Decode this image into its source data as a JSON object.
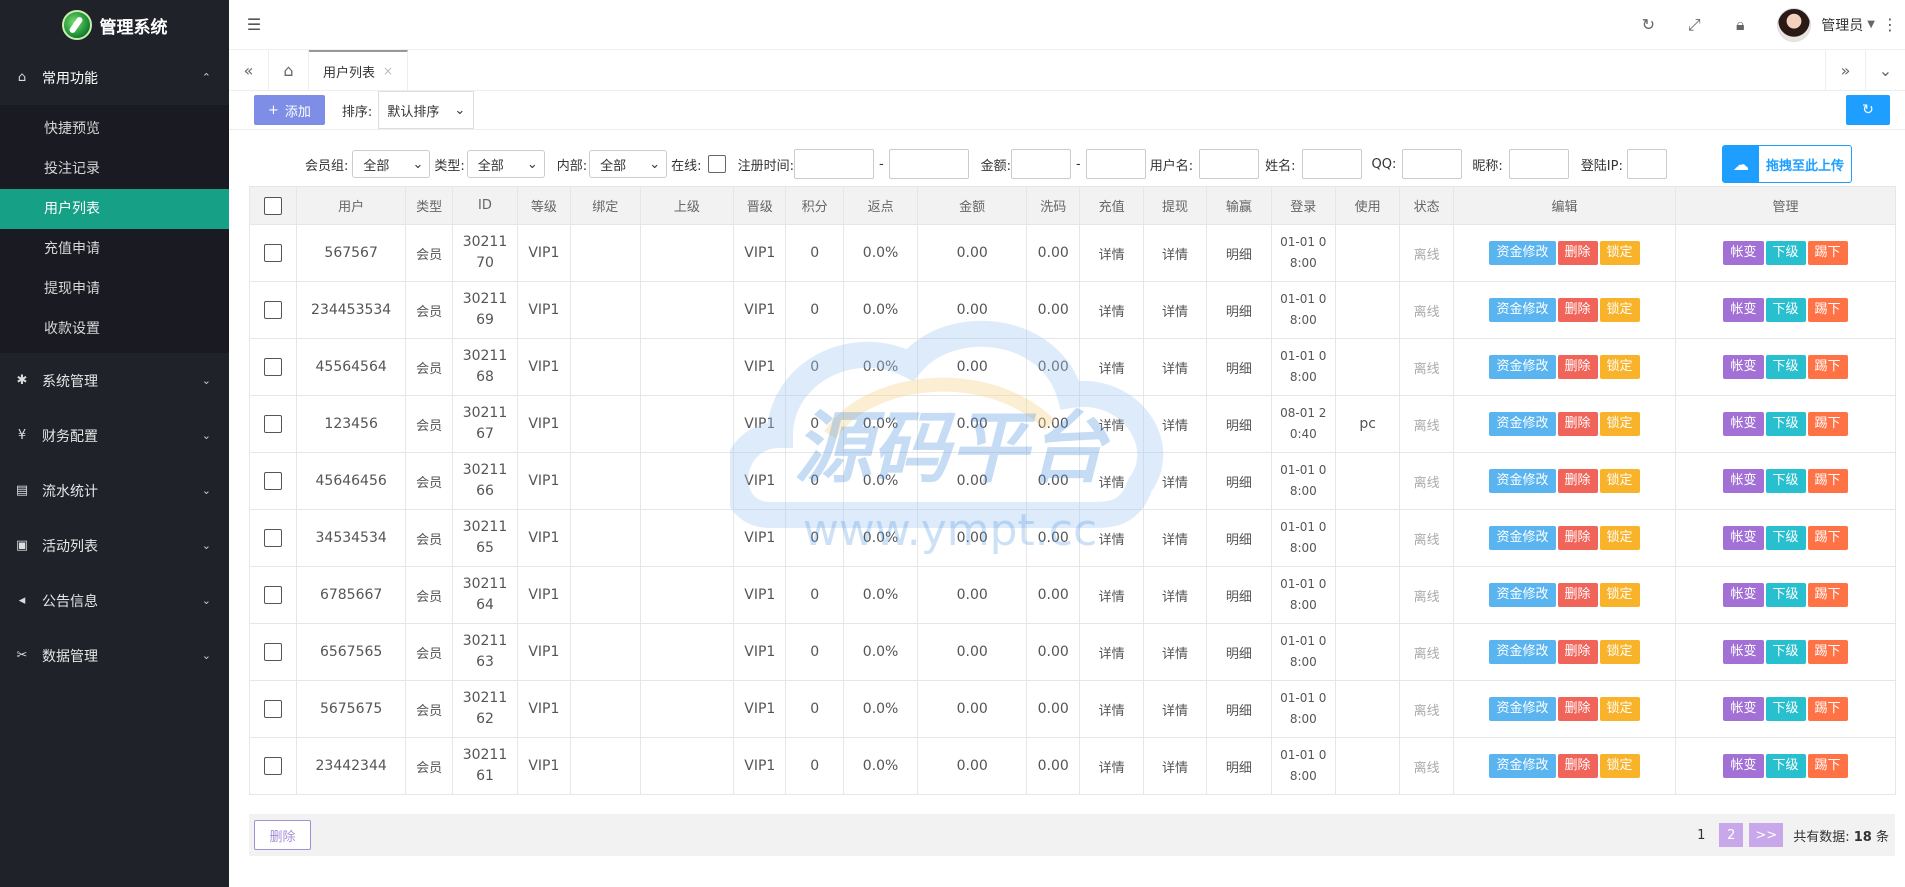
{
  "app": {
    "title": "管理系统"
  },
  "sidebar": {
    "groups": [
      {
        "label": "常用功能",
        "icon": "home-icon",
        "open": true,
        "items": [
          {
            "label": "快捷预览"
          },
          {
            "label": "投注记录"
          },
          {
            "label": "用户列表",
            "active": true
          },
          {
            "label": "充值申请"
          },
          {
            "label": "提现申请"
          },
          {
            "label": "收款设置"
          }
        ]
      },
      {
        "label": "系统管理",
        "icon": "gear-icon"
      },
      {
        "label": "财务配置",
        "icon": "yen-icon"
      },
      {
        "label": "流水统计",
        "icon": "report-icon"
      },
      {
        "label": "活动列表",
        "icon": "gift-icon"
      },
      {
        "label": "公告信息",
        "icon": "speaker-icon"
      },
      {
        "label": "数据管理",
        "icon": "tools-icon"
      }
    ]
  },
  "header": {
    "user_name": "管理员"
  },
  "tabs": [
    {
      "label": "用户列表",
      "close": "×"
    }
  ],
  "toolbar": {
    "add_label": "添加",
    "sort_label": "排序:",
    "sort_value": "默认排序"
  },
  "filters": {
    "member_group_label": "会员组:",
    "member_group_value": "全部",
    "type_label": "类型:",
    "type_value": "全部",
    "internal_label": "内部:",
    "internal_value": "全部",
    "online_label": "在线:",
    "reg_time_label": "注册时间:",
    "dash": "-",
    "amount_label": "金额:",
    "username_label": "用户名:",
    "realname_label": "姓名:",
    "qq_label": "QQ:",
    "nickname_label": "昵称:",
    "login_ip_label": "登陆IP:",
    "upload_label": "拖拽至此上传"
  },
  "table": {
    "columns": [
      "用户",
      "类型",
      "ID",
      "等级",
      "绑定",
      "上级",
      "晋级",
      "积分",
      "返点",
      "金额",
      "洗码",
      "充值",
      "提现",
      "输赢",
      "登录",
      "使用",
      "状态",
      "编辑",
      "管理"
    ],
    "actions": {
      "edit_funds": "资金修改",
      "delete": "删除",
      "lock": "锁定",
      "change": "帐变",
      "downline": "下级",
      "kick": "踢下"
    },
    "rows": [
      {
        "user": "567567",
        "type": "会员",
        "id_a": "30211",
        "id_b": "70",
        "level": "VIP1",
        "bind": "",
        "parent": "",
        "promo": "VIP1",
        "points": "0",
        "rebate": "0.0%",
        "amount": "0.00",
        "wash": "0.00",
        "recharge": "详情",
        "withdraw": "详情",
        "winloss": "明细",
        "login_a": "01-01 0",
        "login_b": "8:00",
        "use": "",
        "status": "离线"
      },
      {
        "user": "234453534",
        "type": "会员",
        "id_a": "30211",
        "id_b": "69",
        "level": "VIP1",
        "bind": "",
        "parent": "",
        "promo": "VIP1",
        "points": "0",
        "rebate": "0.0%",
        "amount": "0.00",
        "wash": "0.00",
        "recharge": "详情",
        "withdraw": "详情",
        "winloss": "明细",
        "login_a": "01-01 0",
        "login_b": "8:00",
        "use": "",
        "status": "离线"
      },
      {
        "user": "45564564",
        "type": "会员",
        "id_a": "30211",
        "id_b": "68",
        "level": "VIP1",
        "bind": "",
        "parent": "",
        "promo": "VIP1",
        "points": "0",
        "rebate": "0.0%",
        "amount": "0.00",
        "wash": "0.00",
        "recharge": "详情",
        "withdraw": "详情",
        "winloss": "明细",
        "login_a": "01-01 0",
        "login_b": "8:00",
        "use": "",
        "status": "离线"
      },
      {
        "user": "123456",
        "type": "会员",
        "id_a": "30211",
        "id_b": "67",
        "level": "VIP1",
        "bind": "",
        "parent": "",
        "promo": "VIP1",
        "points": "0",
        "rebate": "0.0%",
        "amount": "0.00",
        "wash": "0.00",
        "recharge": "详情",
        "withdraw": "详情",
        "winloss": "明细",
        "login_a": "08-01 2",
        "login_b": "0:40",
        "use": "pc",
        "status": "离线"
      },
      {
        "user": "45646456",
        "type": "会员",
        "id_a": "30211",
        "id_b": "66",
        "level": "VIP1",
        "bind": "",
        "parent": "",
        "promo": "VIP1",
        "points": "0",
        "rebate": "0.0%",
        "amount": "0.00",
        "wash": "0.00",
        "recharge": "详情",
        "withdraw": "详情",
        "winloss": "明细",
        "login_a": "01-01 0",
        "login_b": "8:00",
        "use": "",
        "status": "离线"
      },
      {
        "user": "34534534",
        "type": "会员",
        "id_a": "30211",
        "id_b": "65",
        "level": "VIP1",
        "bind": "",
        "parent": "",
        "promo": "VIP1",
        "points": "0",
        "rebate": "0.0%",
        "amount": "0.00",
        "wash": "0.00",
        "recharge": "详情",
        "withdraw": "详情",
        "winloss": "明细",
        "login_a": "01-01 0",
        "login_b": "8:00",
        "use": "",
        "status": "离线"
      },
      {
        "user": "6785667",
        "type": "会员",
        "id_a": "30211",
        "id_b": "64",
        "level": "VIP1",
        "bind": "",
        "parent": "",
        "promo": "VIP1",
        "points": "0",
        "rebate": "0.0%",
        "amount": "0.00",
        "wash": "0.00",
        "recharge": "详情",
        "withdraw": "详情",
        "winloss": "明细",
        "login_a": "01-01 0",
        "login_b": "8:00",
        "use": "",
        "status": "离线"
      },
      {
        "user": "6567565",
        "type": "会员",
        "id_a": "30211",
        "id_b": "63",
        "level": "VIP1",
        "bind": "",
        "parent": "",
        "promo": "VIP1",
        "points": "0",
        "rebate": "0.0%",
        "amount": "0.00",
        "wash": "0.00",
        "recharge": "详情",
        "withdraw": "详情",
        "winloss": "明细",
        "login_a": "01-01 0",
        "login_b": "8:00",
        "use": "",
        "status": "离线"
      },
      {
        "user": "5675675",
        "type": "会员",
        "id_a": "30211",
        "id_b": "62",
        "level": "VIP1",
        "bind": "",
        "parent": "",
        "promo": "VIP1",
        "points": "0",
        "rebate": "0.0%",
        "amount": "0.00",
        "wash": "0.00",
        "recharge": "详情",
        "withdraw": "详情",
        "winloss": "明细",
        "login_a": "01-01 0",
        "login_b": "8:00",
        "use": "",
        "status": "离线"
      },
      {
        "user": "23442344",
        "type": "会员",
        "id_a": "30211",
        "id_b": "61",
        "level": "VIP1",
        "bind": "",
        "parent": "",
        "promo": "VIP1",
        "points": "0",
        "rebate": "0.0%",
        "amount": "0.00",
        "wash": "0.00",
        "recharge": "详情",
        "withdraw": "详情",
        "winloss": "明细",
        "login_a": "01-01 0",
        "login_b": "8:00",
        "use": "",
        "status": "离线"
      }
    ]
  },
  "footer": {
    "delete_label": "删除",
    "pages": [
      "1",
      "2"
    ],
    "current_page": "2",
    "next_label": ">>",
    "total_prefix": "共有数据:",
    "total_count": "18",
    "total_suffix": "条"
  },
  "watermark": {
    "title": "源码平台",
    "url": "www.ympt.cc"
  },
  "colors": {
    "sidebar_bg": "#20222a",
    "active_item": "#16a085",
    "add_button": "#7e8ee6",
    "refresh_button": "#1e9fff"
  }
}
